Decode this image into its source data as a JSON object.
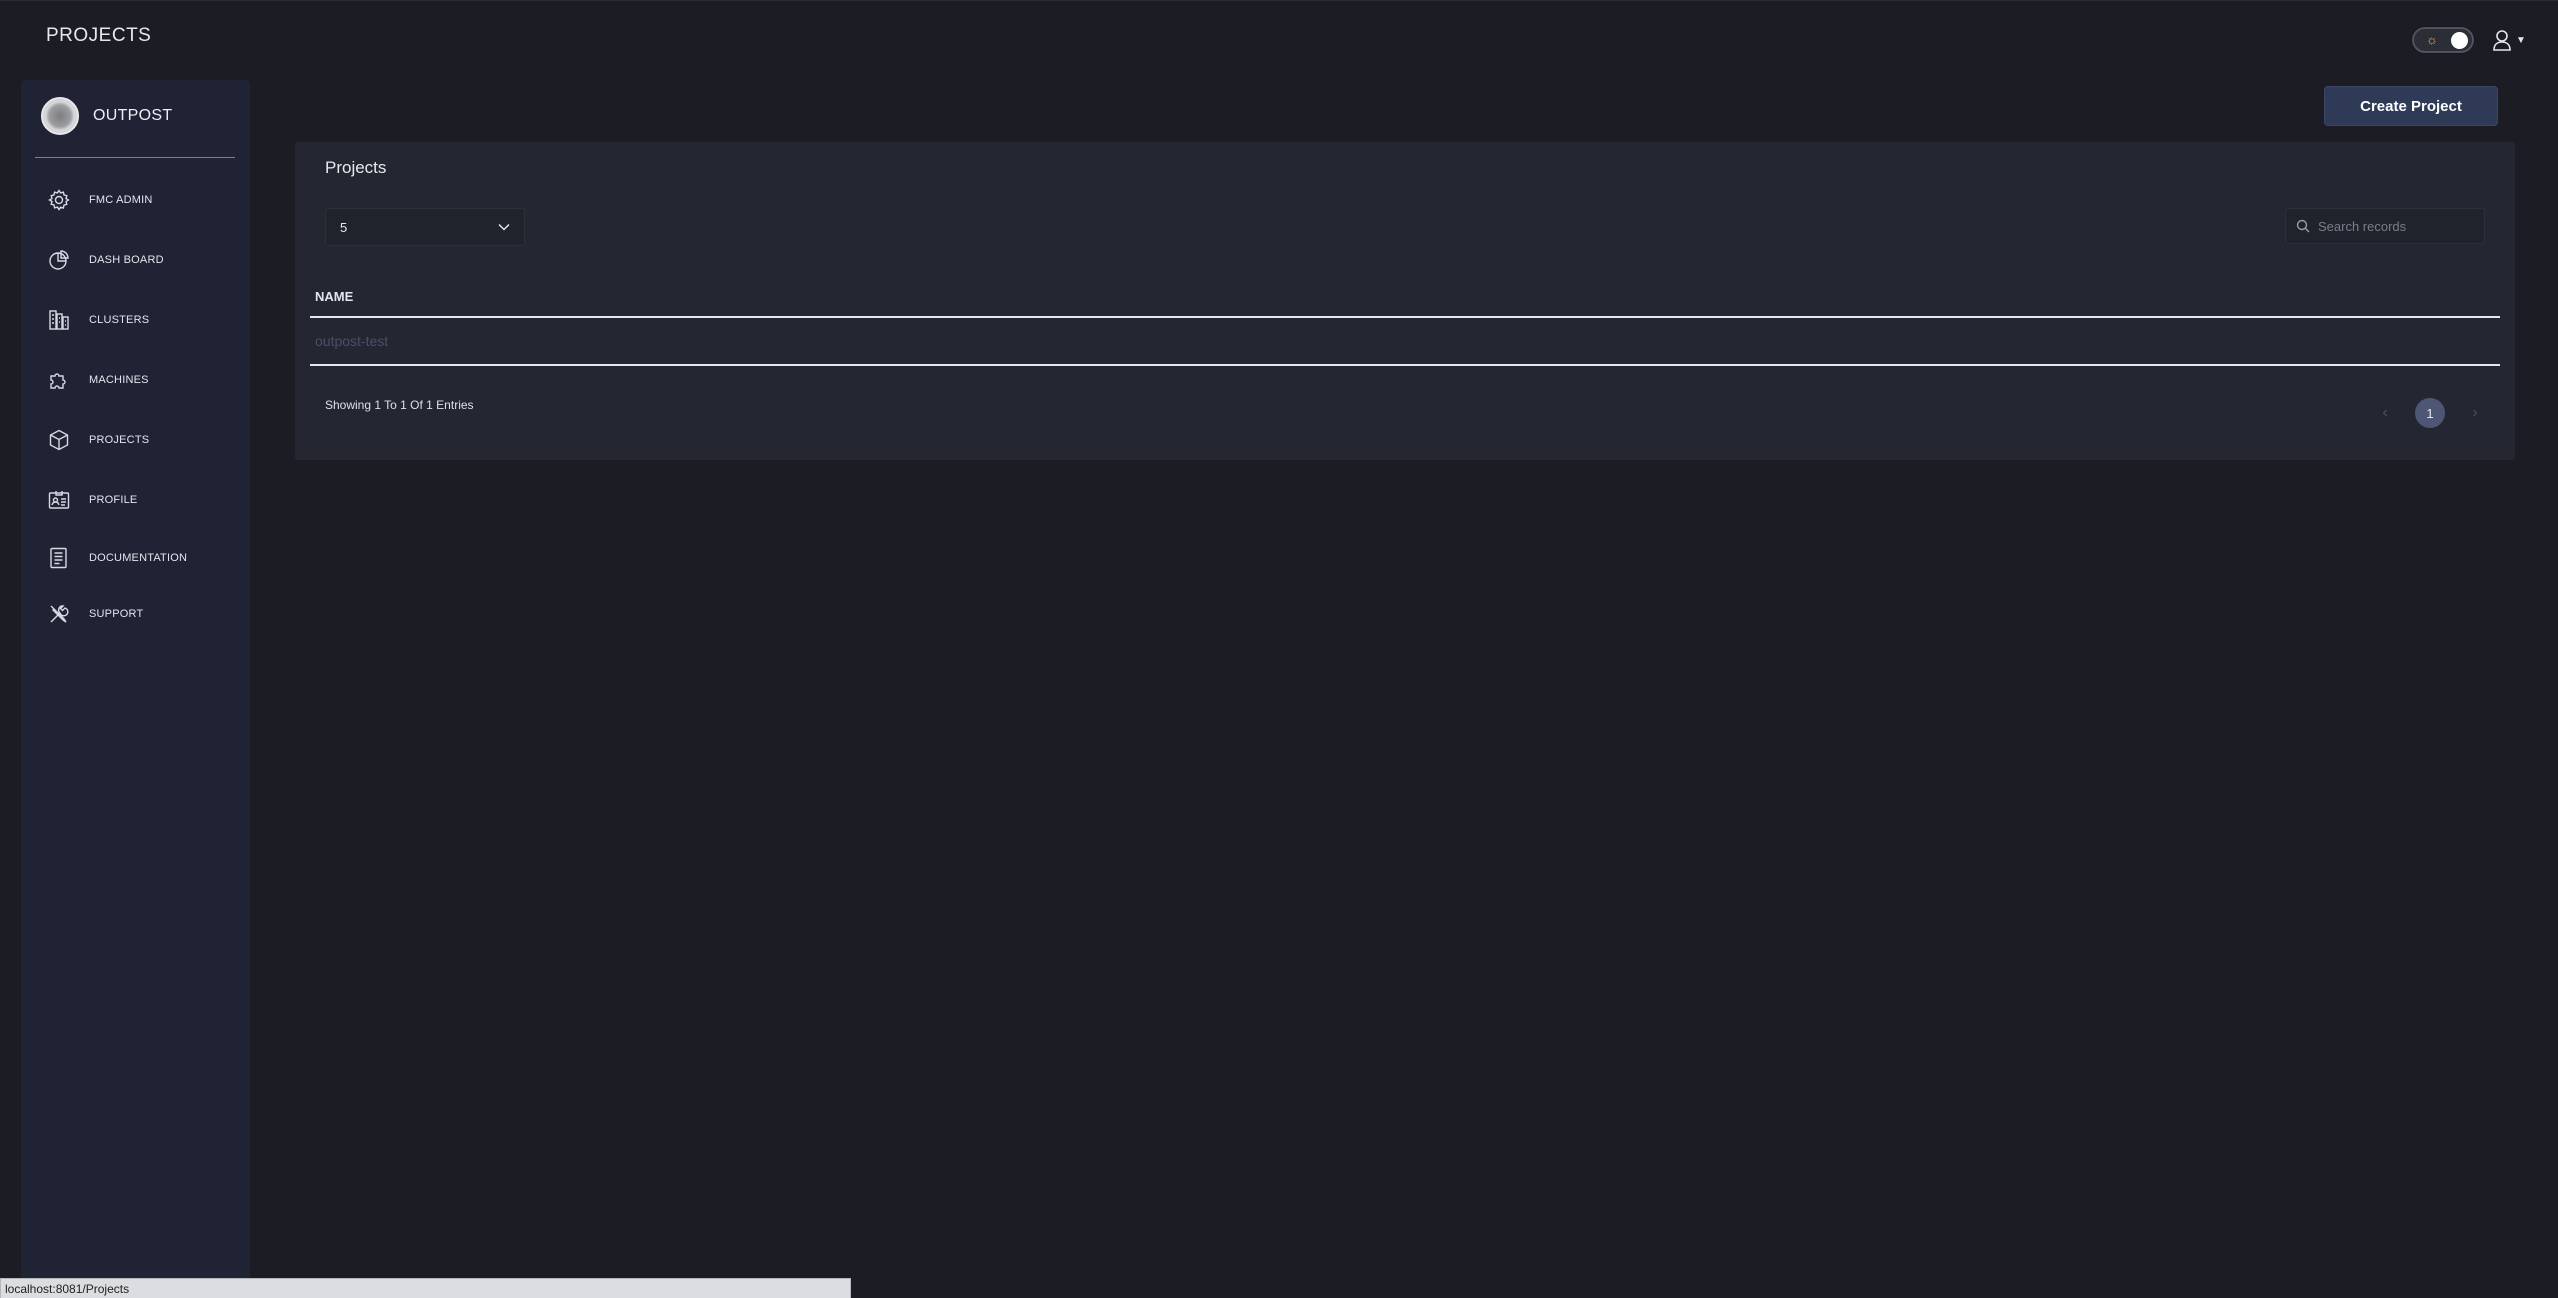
{
  "header": {
    "page_title": "PROJECTS"
  },
  "theme_toggle": {
    "icon": "sun-icon",
    "state": "dark"
  },
  "user_menu": {
    "icon": "user-icon"
  },
  "sidebar": {
    "brand_name": "OUTPOST",
    "items": [
      {
        "label": "FMC ADMIN",
        "icon": "gear-icon"
      },
      {
        "label": "DASH BOARD",
        "icon": "pie-chart-icon"
      },
      {
        "label": "CLUSTERS",
        "icon": "cluster-icon"
      },
      {
        "label": "MACHINES",
        "icon": "puzzle-icon"
      },
      {
        "label": "PROJECTS",
        "icon": "cube-icon"
      },
      {
        "label": "PROFILE",
        "icon": "id-card-icon"
      },
      {
        "label": "DOCUMENTATION",
        "icon": "document-icon"
      },
      {
        "label": "SUPPORT",
        "icon": "tools-icon"
      }
    ]
  },
  "main": {
    "create_button": "Create Project",
    "card_title": "Projects",
    "page_size": "5",
    "search_placeholder": "Search records",
    "table": {
      "columns": [
        "NAME"
      ],
      "rows": [
        {
          "name": "outpost-test"
        }
      ]
    },
    "showing_text": "Showing 1 To 1 Of 1 Entries",
    "pagination": {
      "current_page": "1"
    }
  },
  "status_bar": {
    "url": "localhost:8081/Projects"
  },
  "colors": {
    "background": "#1c1d24",
    "sidebar": "#1f2333",
    "card": "#242632",
    "accent_button": "#2f3a57",
    "active_page": "#4d5775",
    "toggle_sun": "#f3b43a"
  }
}
